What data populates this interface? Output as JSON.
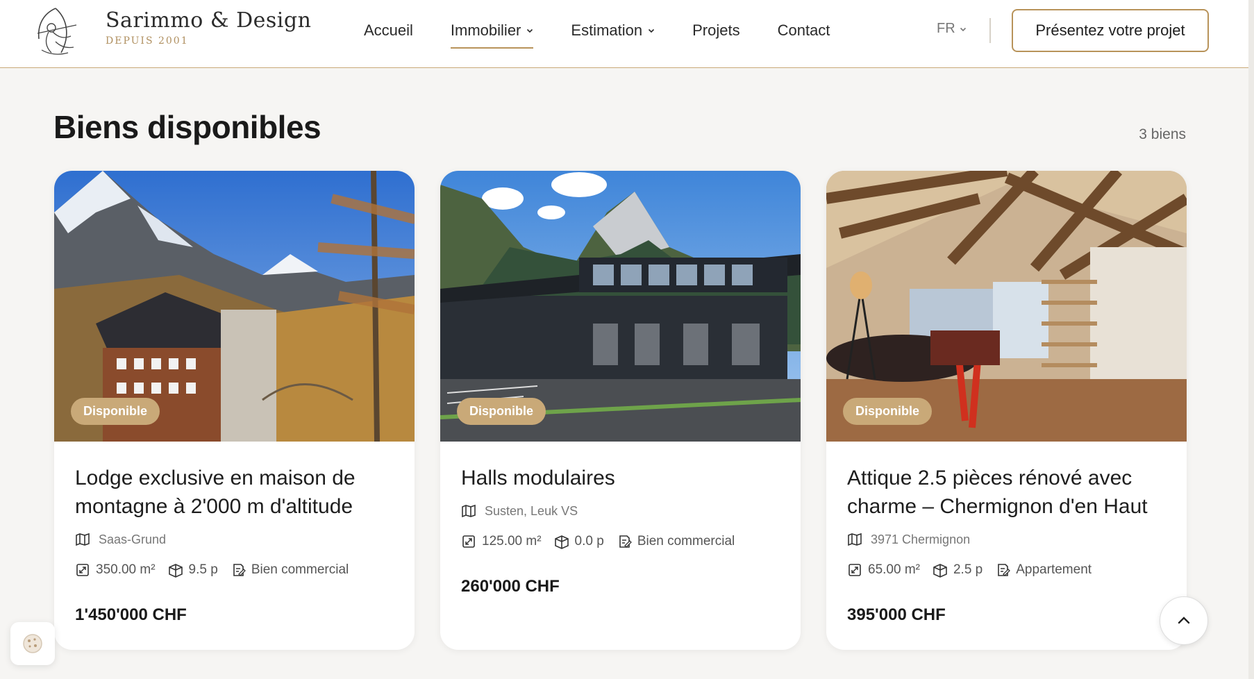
{
  "header": {
    "brand_name": "Sarimmo & Design",
    "brand_sub": "DEPUIS 2001",
    "nav": [
      {
        "label": "Accueil",
        "dropdown": false,
        "active": false
      },
      {
        "label": "Immobilier",
        "dropdown": true,
        "active": true
      },
      {
        "label": "Estimation",
        "dropdown": true,
        "active": false
      },
      {
        "label": "Projets",
        "dropdown": false,
        "active": false
      },
      {
        "label": "Contact",
        "dropdown": false,
        "active": false
      }
    ],
    "lang": "FR",
    "cta": "Présentez votre projet"
  },
  "section": {
    "title": "Biens disponibles",
    "count": "3 biens"
  },
  "listings": [
    {
      "badge": "Disponible",
      "title": "Lodge exclusive en maison de montagne à 2'000 m d'altitude",
      "location": "Saas-Grund",
      "area": "350.00 m²",
      "rooms": "9.5 p",
      "type": "Bien commercial",
      "price": "1'450'000 CHF",
      "image": "mountain-chalet-photo"
    },
    {
      "badge": "Disponible",
      "title": "Halls modulaires",
      "location": "Susten, Leuk VS",
      "area": "125.00 m²",
      "rooms": "0.0 p",
      "type": "Bien commercial",
      "price": "260'000 CHF",
      "image": "modular-halls-photo"
    },
    {
      "badge": "Disponible",
      "title": "Attique 2.5 pièces rénové avec charme – Chermignon d'en Haut",
      "location": "3971 Chermignon",
      "area": "65.00 m²",
      "rooms": "2.5 p",
      "type": "Appartement",
      "price": "395'000 CHF",
      "image": "attic-apartment-photo"
    }
  ],
  "colors": {
    "accent": "#c9a978",
    "accent_dark": "#b8935a",
    "background": "#f6f5f3"
  },
  "icons": [
    "logo-archer-icon",
    "chevron-down-icon",
    "map-pin-icon",
    "area-icon",
    "rooms-icon",
    "property-type-icon",
    "chevron-up-icon",
    "cookie-icon"
  ]
}
